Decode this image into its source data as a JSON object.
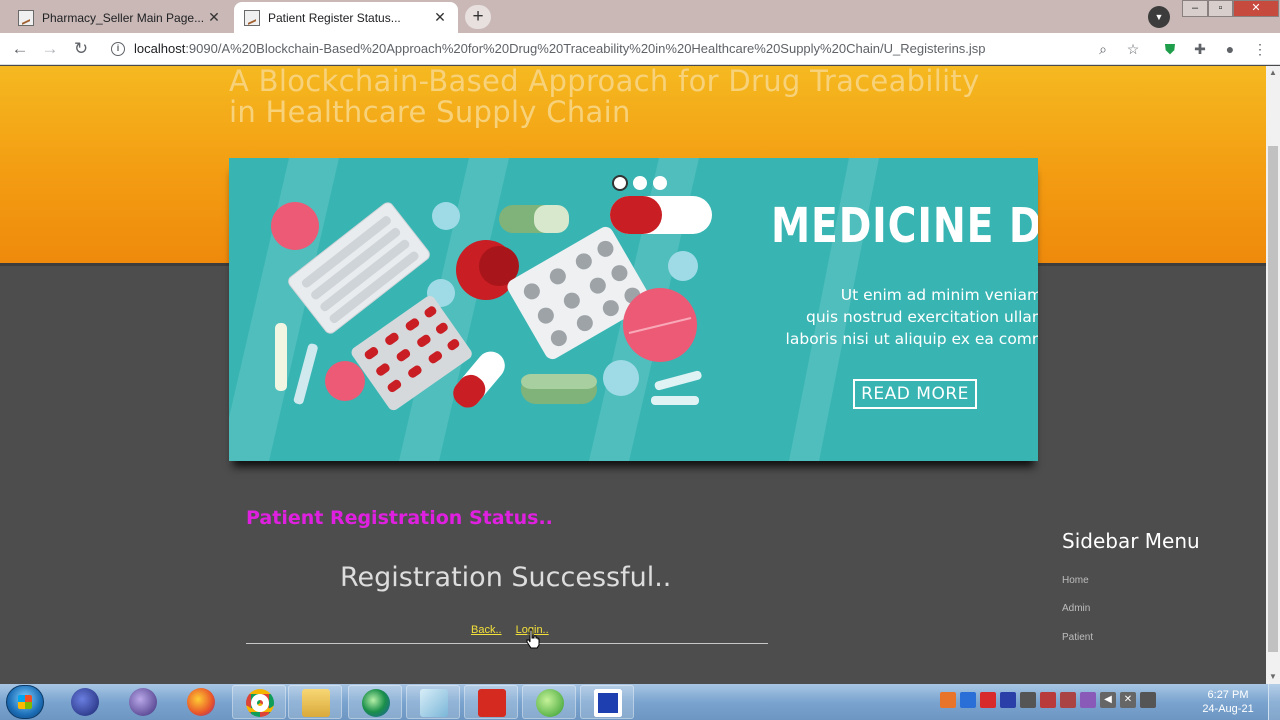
{
  "browser": {
    "tabs": [
      {
        "title": "Pharmacy_Seller Main Page...",
        "active": false,
        "close": "✕"
      },
      {
        "title": "Patient Register Status...",
        "active": true,
        "close": "✕"
      }
    ],
    "new_tab": "+",
    "url_host": "localhost",
    "url_path": ":9090/A%20Blockchain-Based%20Approach%20for%20Drug%20Traceability%20in%20Healthcare%20Supply%20Chain/U_Registerins.jsp"
  },
  "page": {
    "site_title": "A Blockchain-Based Approach for Drug Traceability in Healthcare Supply Chain",
    "banner": {
      "title": "MEDICINE DRUG",
      "text_lines": [
        "Ut enim ad minim veniam,",
        "quis nostrud exercitation ullam",
        "laboris nisi ut aliquip ex ea comm"
      ],
      "button": "READ MORE"
    },
    "status_heading": "Patient Registration Status..",
    "message": "Registration Successful..",
    "links": {
      "back": "Back..",
      "login": "Login.."
    },
    "sidebar": {
      "title": "Sidebar Menu",
      "items": [
        {
          "label": "Home"
        },
        {
          "label": "Admin"
        },
        {
          "label": "Patient"
        }
      ]
    }
  },
  "taskbar": {
    "time": "6:27 PM",
    "date": "24-Aug-21"
  },
  "colors": {
    "header_orange": "#f39c12",
    "status_heading": "#e020e0",
    "link_yellow": "#f3e03a",
    "banner_teal": "#38b5b3"
  }
}
